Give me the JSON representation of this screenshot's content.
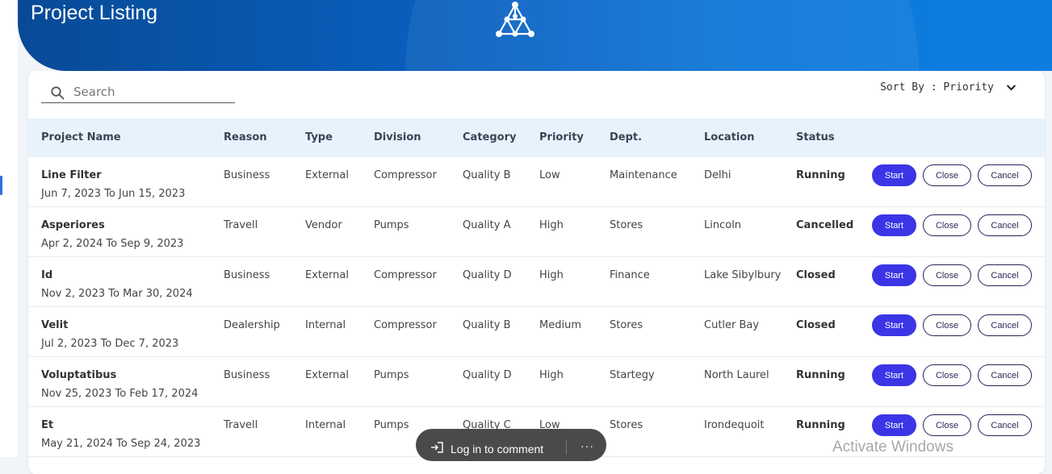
{
  "header": {
    "title": "Project Listing"
  },
  "search": {
    "placeholder": "Search"
  },
  "sort": {
    "label": "Sort By : Priority"
  },
  "table": {
    "columns": [
      "Project Name",
      "Reason",
      "Type",
      "Division",
      "Category",
      "Priority",
      "Dept.",
      "Location",
      "Status"
    ],
    "rows": [
      {
        "name": "Line Filter",
        "dates": "Jun 7, 2023 To Jun 15, 2023",
        "reason": "Business",
        "type": "External",
        "division": "Compressor",
        "category": "Quality B",
        "priority": "Low",
        "dept": "Maintenance",
        "location": "Delhi",
        "status": "Running"
      },
      {
        "name": "Asperiores",
        "dates": "Apr 2, 2024 To Sep 9, 2023",
        "reason": "Travell",
        "type": "Vendor",
        "division": "Pumps",
        "category": "Quality A",
        "priority": "High",
        "dept": "Stores",
        "location": "Lincoln",
        "status": "Cancelled"
      },
      {
        "name": "Id",
        "dates": "Nov 2, 2023 To Mar 30, 2024",
        "reason": "Business",
        "type": "External",
        "division": "Compressor",
        "category": "Quality D",
        "priority": "High",
        "dept": "Finance",
        "location": "Lake Sibylbury",
        "status": "Closed"
      },
      {
        "name": "Velit",
        "dates": "Jul 2, 2023 To Dec 7, 2023",
        "reason": "Dealership",
        "type": "Internal",
        "division": "Compressor",
        "category": "Quality B",
        "priority": "Medium",
        "dept": "Stores",
        "location": "Cutler Bay",
        "status": "Closed"
      },
      {
        "name": "Voluptatibus",
        "dates": "Nov 25, 2023 To Feb 17, 2024",
        "reason": "Business",
        "type": "External",
        "division": "Pumps",
        "category": "Quality D",
        "priority": "High",
        "dept": "Startegy",
        "location": "North Laurel",
        "status": "Running"
      },
      {
        "name": "Et",
        "dates": "May 21, 2024 To Sep 24, 2023",
        "reason": "Travell",
        "type": "Internal",
        "division": "Pumps",
        "category": "Quality C",
        "priority": "Low",
        "dept": "Stores",
        "location": "Irondequoit",
        "status": "Running"
      }
    ]
  },
  "actions": {
    "start": "Start",
    "close": "Close",
    "cancel": "Cancel"
  },
  "comment_bar": {
    "label": "Log in to comment",
    "more": "···"
  },
  "watermark": {
    "text": "Activate Windows"
  },
  "colors": {
    "banner": "#0a5cb8",
    "header_row": "#e7f3fc",
    "start_button": "#3b35e6",
    "outline_button": "#25255a"
  },
  "icons": {
    "search": "search-icon",
    "sort": "chevron-down-icon",
    "logo": "network-triangle-logo",
    "login": "login-arrow-icon"
  }
}
